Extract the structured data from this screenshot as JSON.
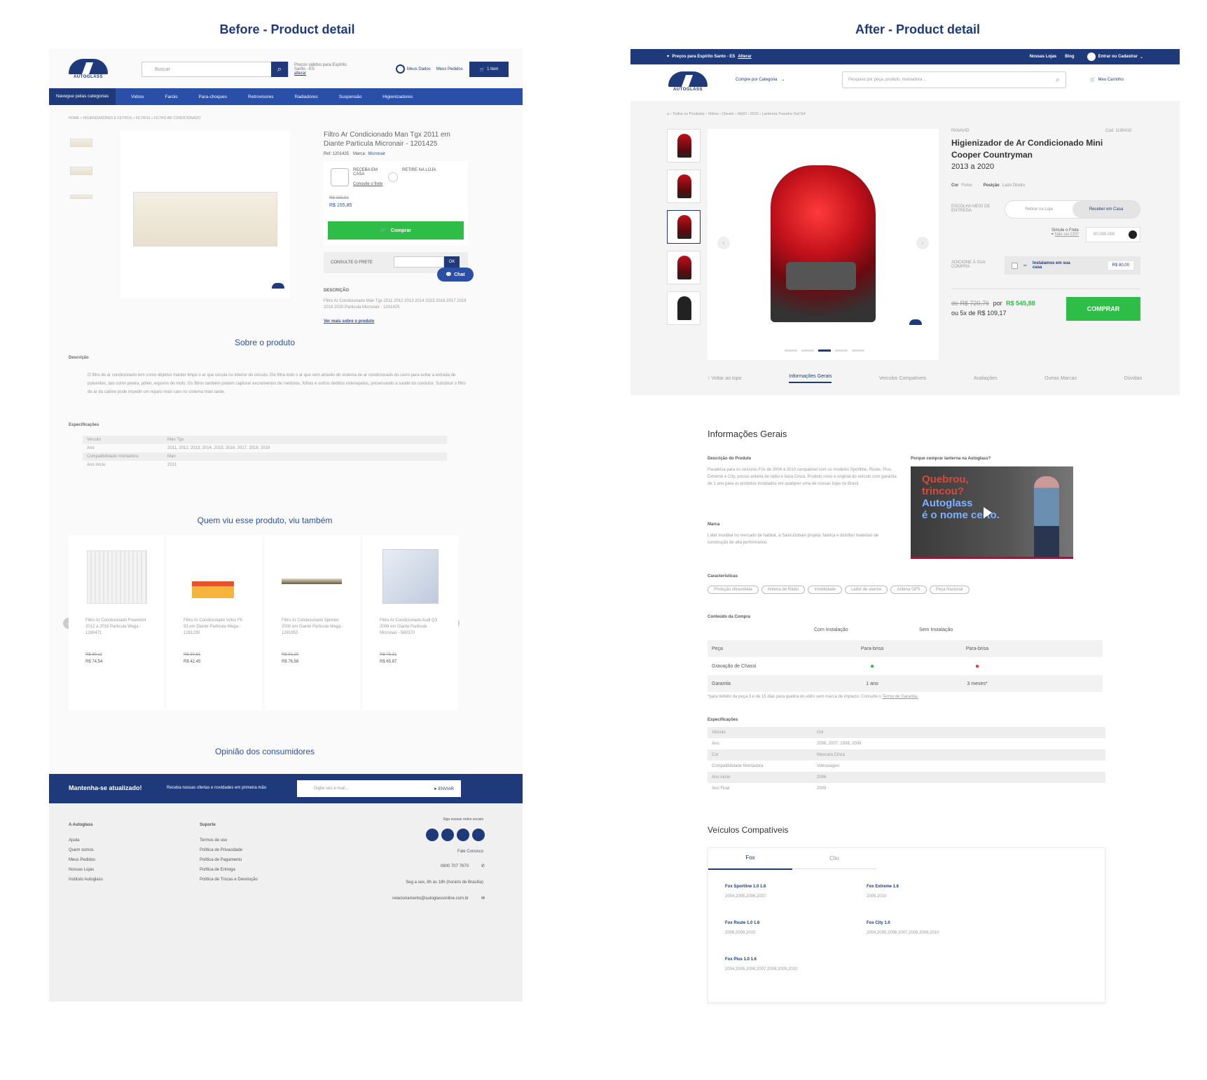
{
  "headings": {
    "before": "Before - Product detail",
    "after": "After - Product detail"
  },
  "before": {
    "logo_text": "AUTOGLASS",
    "search_placeholder": "Buscar",
    "location": "Preços válidos para Espírito Santo - ES",
    "location_change": "alterar",
    "my_data": "Meus Dados",
    "my_orders": "Meus Pedidos",
    "cart": "1 item",
    "nav": [
      "Navegue pelas categorias",
      "Vidros",
      "Faróis",
      "Para-choques",
      "Retrovisores",
      "Radiadores",
      "Suspensão",
      "Higienizadores"
    ],
    "breadcrumb": "HOME » HIGIENIZADORES E FILTROS » FILTROS » FILTRO AR CONDICIONADO",
    "product_title": "Filtro Ar Condicionado Man Tgx 2011 em Diante Particula Micronair - 1201425",
    "ref": "Ref: 1201425",
    "brand_label": "Marca:",
    "brand": "Micronair",
    "delivery_home": "RECEBA EM CASA",
    "delivery_store": "RETIRE NA LOJA",
    "freight_link": "Consulte o frete",
    "old_price": "R$ 183,92",
    "price": "R$ 155,85",
    "buy": "Comprar",
    "freight_label": "CONSULTE O FRETE",
    "ok": "OK",
    "chat": "Chat",
    "desc_label": "DESCRIÇÃO",
    "desc_text": "Filtro Ar Condicionado Man Tgx 2011 2012 2013 2014 2015 2016 2017 2018 2019 2020 Particula Micronair - 1201425",
    "see_more": "Ver mais sobre o produto",
    "about": "Sobre o produto",
    "description_title": "Descrição",
    "description": "O filtro do ar condicionado tem como objetivo manter limpo o ar que circula no interior do veículo. Ele filtra todo o ar que vem através do sistema de ar condicionado do carro para evitar a entrada de poluentes, tais como poeira, pólen, esporos de mofo. Os filtros também podem capturar excrementos de roedores, folhas e outros detritos indesejados, preservando a saúde do condutor. Substituir o filtro de ar da cabine pode impedir um reparo mais caro no sistema mais tarde.",
    "specs_title": "Especificações",
    "specs": [
      [
        "Veículo",
        "Man Tgx"
      ],
      [
        "Ano",
        "2011, 2012, 2013, 2014, 2015, 2016, 2017, 2018, 2019"
      ],
      [
        "Compatibilidade montadora",
        "Man"
      ],
      [
        "Ano início",
        "2011"
      ]
    ],
    "also_viewed": "Quem viu esse produto, viu também",
    "related": [
      {
        "name": "Filtro Ar Condicionado Freemont 2012 a 2016 Particula Wega - 1280471",
        "old": "R$ 89,11",
        "price": "R$ 74,54"
      },
      {
        "name": "Filtro Ar Condicionado Volvo Fh 93 em Diante Particula Wega - 1281230",
        "old": "R$ 50,61",
        "price": "R$ 42,45"
      },
      {
        "name": "Filtro Ar Condicionado Sprinter 2000 em Diante Particula Wega - 1281953",
        "old": "R$ 91,20",
        "price": "R$ 76,58"
      },
      {
        "name": "Filtro Ar Condicionado Audi Q3 2006 em Diante Particula Micronair - 560370",
        "old": "R$ 78,31",
        "price": "R$ 65,87"
      }
    ],
    "opinions": "Opinião dos consumidores",
    "newsletter_title": "Mantenha-se atualizado!",
    "newsletter_text": "Receba nossas ofertas e novidades em primeira mão",
    "newsletter_placeholder": "Digite seu e-mail...",
    "send": "ENVIAR",
    "footer_col1_title": "A Autoglass",
    "footer_col1": [
      "Ajuda",
      "Quem somos",
      "Meus Pedidos",
      "Nossas Lojas",
      "Instituto Autoglass"
    ],
    "footer_col2_title": "Suporte",
    "footer_col2": [
      "Termos de uso",
      "Política de Privacidade",
      "Política de Pagamento",
      "Política de Entrega",
      "Política de Trocas e Devolução"
    ],
    "social_label": "Siga nossas redes sociais",
    "contact": "Fale Conosco",
    "phone": "0800 707 7670",
    "hours": "Seg a sex, 8h às 18h (horário de Brasília)",
    "email": "relacionamento@autoglassonline.com.br"
  },
  "after": {
    "location": "Preços para Espírito Santo - ES",
    "location_change": "Alterar",
    "stores": "Nossas Lojas",
    "blog": "Blog",
    "login": "Entrar ou Cadastrar",
    "logo_text": "AUTOGLASS",
    "category": "Compre por Categoria",
    "search_placeholder": "Pesquise por peça, produto, montadora ...",
    "cart": "Meu Carrinho",
    "breadcrumb": "Todos os Produtos › Vidros › Oeram › Hb20 › 2015 › Lanterna Traseira Gol G4",
    "brand": "PANAVID",
    "code": "Cód. 1190410",
    "title": "Higienizador de Ar Condicionado Mini Cooper Countryman",
    "years": "2013 a 2020",
    "color_label": "Cor",
    "color": "Fume",
    "position_label": "Posição",
    "position": "Lado Direito",
    "delivery_label": "ESCOLHA MEIO DE ENTREGA",
    "pickup": "Retirar na Loja",
    "home": "Receber em Casa",
    "simulate": "Simule o Frete",
    "cep_link": "Não sei CEP",
    "cep_placeholder": "00.000-000",
    "addon_label": "ADICIONE À SUA COMPRA",
    "addon": "Instalamos em sua casa",
    "addon_price": "R$ 80,00",
    "price_from": "de R$ 720,76",
    "price_por": "por",
    "price": "R$ 545,88",
    "installments": "ou 5x de R$ 109,17",
    "buy": "COMPRAR",
    "tabs": [
      "Voltar ao topo",
      "Informações Gerais",
      "Veículos Compatíveis",
      "Avaliações",
      "Outras Marcas",
      "Dúvidas"
    ],
    "info_title": "Informações Gerais",
    "desc_title": "Descrição do Produto",
    "desc": "Parabrisa para os veículos Fox de 2004 à 2010 compatível com os modelos Sportline, Route, Plus, Extreme e City, possui antena de rádio e faixa Cinza. Produto novo e original do veículo com garantia de 1 ano para os produtos instalados em qualquer uma de nossas lojas no Brasil.",
    "brand_title": "Marca",
    "brand_desc": "Líder mundial no mercado de habitat, a Saint-Gobain projeta, fabrica e distribui materiais de construção de alta performance.",
    "video_title": "Porque comprar lanterna na Autoglass?",
    "video_text": [
      "Quebrou,",
      "trincou?",
      "Autoglass",
      "é o nome certo."
    ],
    "features_title": "Características",
    "features": [
      "Proteção ultravioleta",
      "Antena de Rádio",
      "Imobilidade",
      "Leitor de alarme",
      "Antena GPS",
      "Peça Nacional"
    ],
    "contents_title": "Conteúdo da Compra",
    "col_with": "Com Instalação",
    "col_without": "Sem Instalação",
    "contents": [
      [
        "Peça",
        "Para-brisa",
        "Para-brisa"
      ],
      [
        "Gravação de Chassi",
        "",
        ""
      ],
      [
        "Garantia",
        "1 ano",
        "3 meses*"
      ]
    ],
    "footnote": "*para defeito da peça 3 e de 15 dias para quebra do vidro sem marca de impacto. Consulte o",
    "footnote_link": "Termo de Garantia.",
    "specs_title": "Especificações",
    "specs": [
      [
        "Veículo",
        "Gol"
      ],
      [
        "Ano",
        "2006, 2007, 2008, 2009"
      ],
      [
        "Cor",
        "Mascara Cinza"
      ],
      [
        "Compatibilidade Montadora",
        "Volkswagen"
      ],
      [
        "Ano início",
        "2006"
      ],
      [
        "Ano Final",
        "2009"
      ]
    ],
    "compat_title": "Veículos Compatíveis",
    "compat_tabs": [
      "Fox",
      "Clio"
    ],
    "compat": [
      {
        "name": "Fox Sportline 1.0 1.6",
        "years": "2004,2005,2006,2007"
      },
      {
        "name": "Fox Extreme 1.6",
        "years": "2009,2010"
      },
      {
        "name": "Fox Route 1.0 1.6",
        "years": "2008,2009,2010"
      },
      {
        "name": "Fox City 1.0",
        "years": "2004,2005,2006,2007,2008,2009,2010"
      },
      {
        "name": "Fox Plus 1.0 1.6",
        "years": "2004,2005,2006,2007,2008,2009,2010"
      }
    ]
  }
}
